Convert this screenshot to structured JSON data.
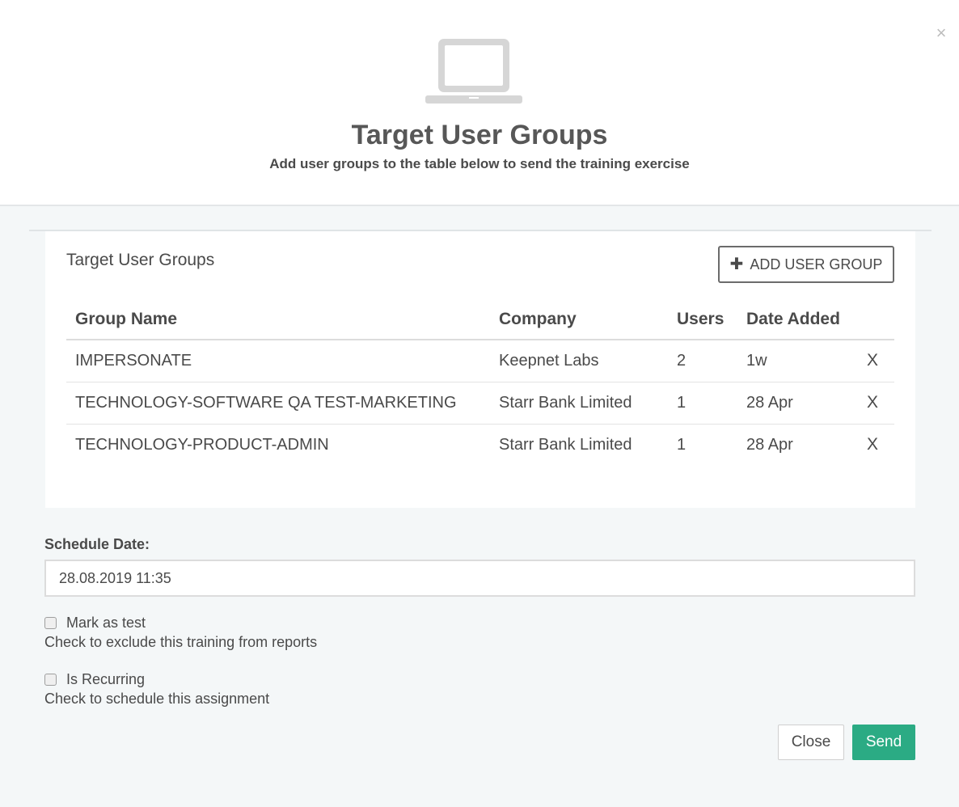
{
  "header": {
    "title": "Target User Groups",
    "subtitle": "Add user groups to the table below to send the training exercise",
    "close_label": "×"
  },
  "card": {
    "title": "Target User Groups",
    "add_button_label": "ADD USER GROUP",
    "columns": [
      "Group Name",
      "Company",
      "Users",
      "Date Added"
    ],
    "rows": [
      {
        "name": "IMPERSONATE",
        "company": "Keepnet Labs",
        "users": "2",
        "date": "1w",
        "remove": "X"
      },
      {
        "name": "TECHNOLOGY-SOFTWARE QA TEST-MARKETING",
        "company": "Starr Bank Limited",
        "users": "1",
        "date": "28 Apr",
        "remove": "X"
      },
      {
        "name": "TECHNOLOGY-PRODUCT-ADMIN",
        "company": "Starr Bank Limited",
        "users": "1",
        "date": "28 Apr",
        "remove": "X"
      }
    ]
  },
  "schedule": {
    "label": "Schedule Date:",
    "value": "28.08.2019 11:35"
  },
  "options": {
    "mark_test_label": "Mark as test",
    "mark_test_help": "Check to exclude this training from reports",
    "recurring_label": "Is Recurring",
    "recurring_help": "Check to schedule this assignment"
  },
  "footer": {
    "close_label": "Close",
    "send_label": "Send"
  },
  "colors": {
    "accent": "#2bab84",
    "background": "#f4f7f8"
  },
  "icons": [
    "laptop-icon",
    "plus-icon",
    "close-icon"
  ]
}
